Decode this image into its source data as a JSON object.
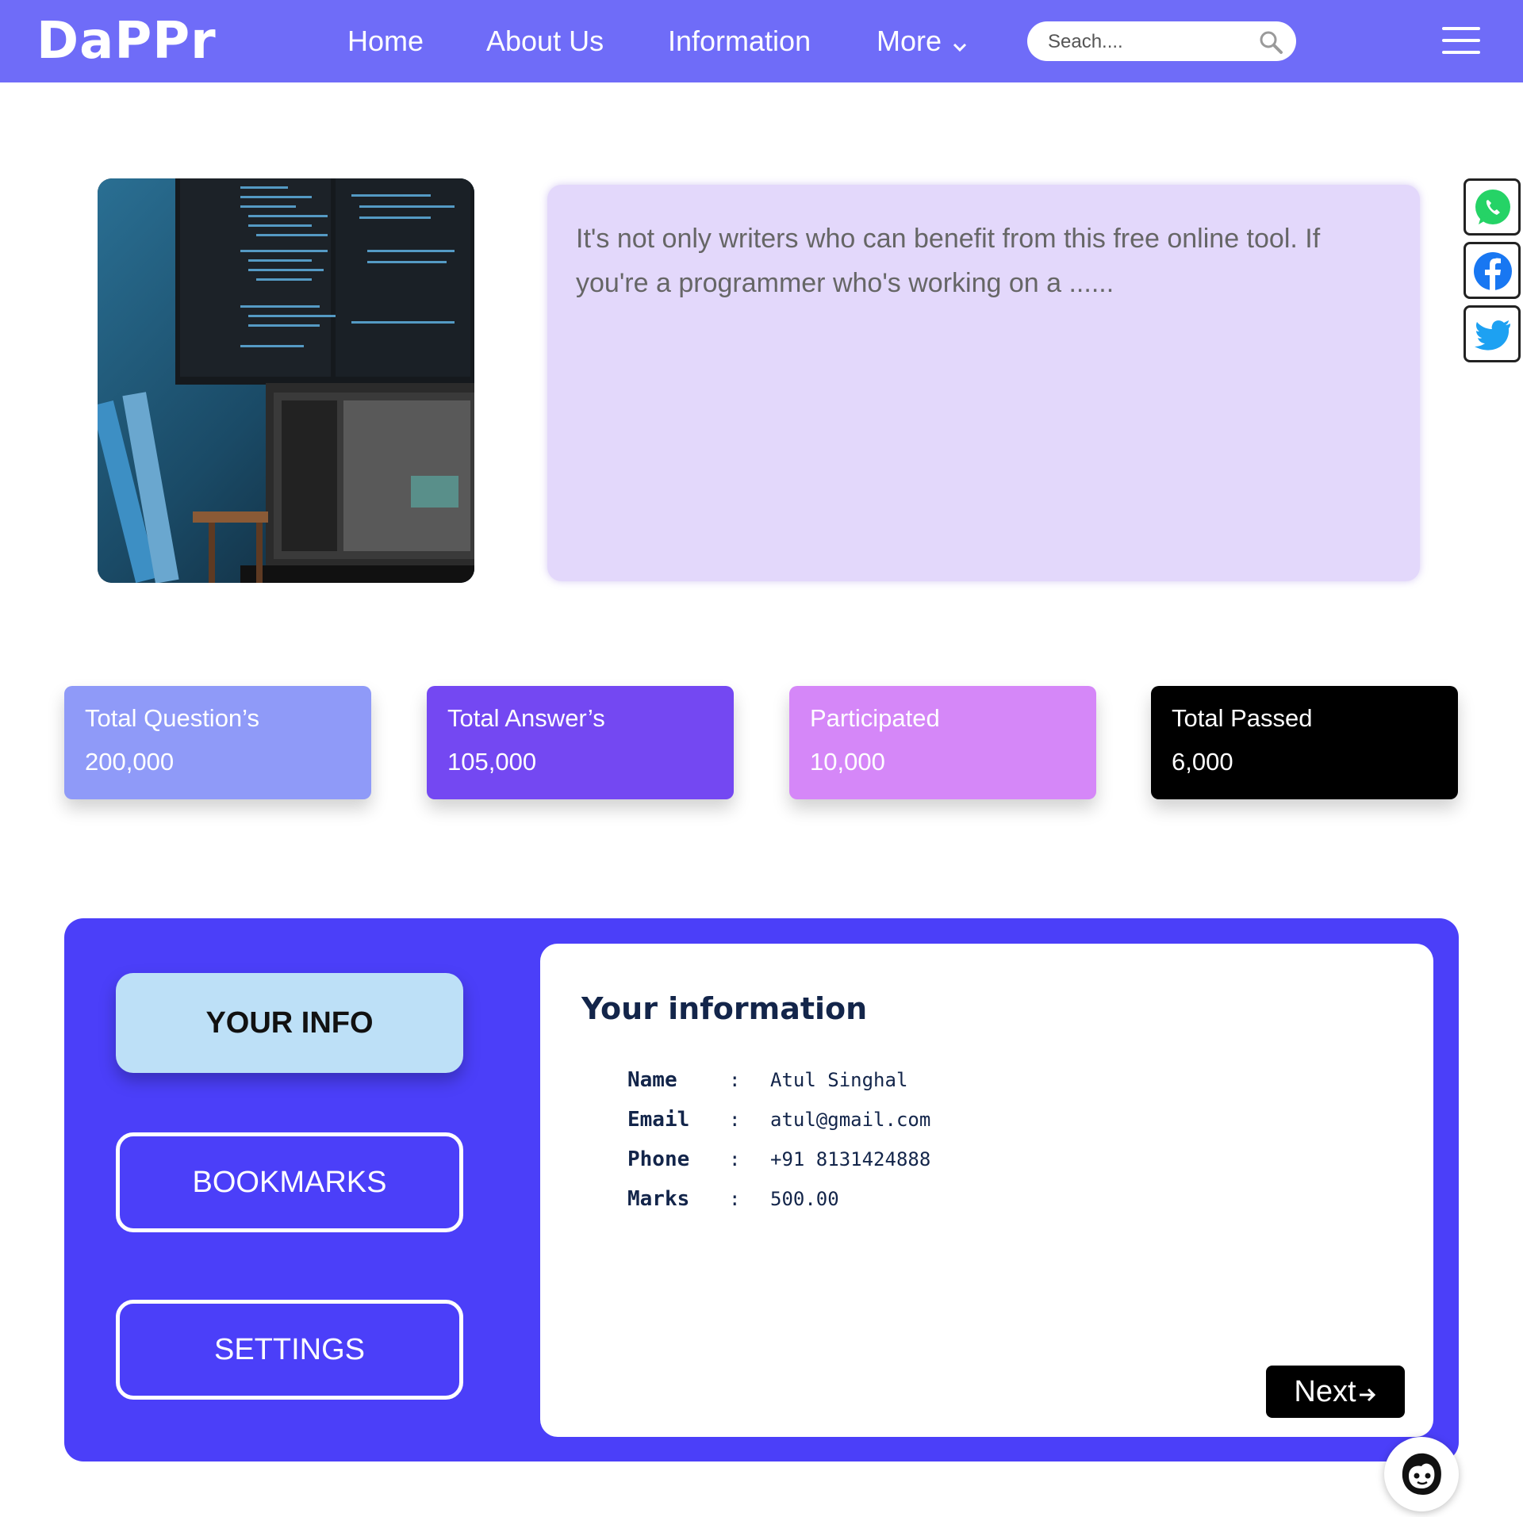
{
  "navbar": {
    "logo": "DaPPr",
    "links": [
      "Home",
      "About Us",
      "Information",
      "More"
    ],
    "search_placeholder": "Seach....",
    "icons": {
      "search": "search-icon",
      "menu": "hamburger-menu-icon",
      "more": "chevron-down-icon"
    }
  },
  "hero": {
    "image": "programmer-workspace-photo",
    "text": "It's not only writers who can benefit from this free online tool. If you're a programmer who's working on a ......"
  },
  "social": [
    "whatsapp-icon",
    "facebook-icon",
    "twitter-icon"
  ],
  "stats": [
    {
      "label": "Total Question’s",
      "value": "200,000",
      "color": "#8f9af8"
    },
    {
      "label": "Total Answer’s",
      "value": "105,000",
      "color": "#7448f2"
    },
    {
      "label": "Participated",
      "value": "10,000",
      "color": "#d587f8"
    },
    {
      "label": "Total Passed",
      "value": "6,000",
      "color": "#000000"
    }
  ],
  "profile": {
    "nav": [
      "YOUR INFO",
      "BOOKMARKS",
      "SETTINGS"
    ],
    "title": "Your information",
    "fields": [
      {
        "key": "Name",
        "value": "Atul Singhal"
      },
      {
        "key": "Email",
        "value": "atul@gmail.com"
      },
      {
        "key": "Phone",
        "value": "+91 8131424888"
      },
      {
        "key": "Marks",
        "value": "500.00"
      }
    ],
    "separator": ":",
    "next_label": "Next",
    "next_icon": "arrow-right-icon"
  },
  "support": {
    "icon": "chat-support-avatar-icon"
  },
  "colors": {
    "nav_bg": "#6f6cf8",
    "panel_bg": "#4b3ff9",
    "hero_card_bg": "#e3d8fb",
    "active_tab_bg": "#bde0f7"
  }
}
